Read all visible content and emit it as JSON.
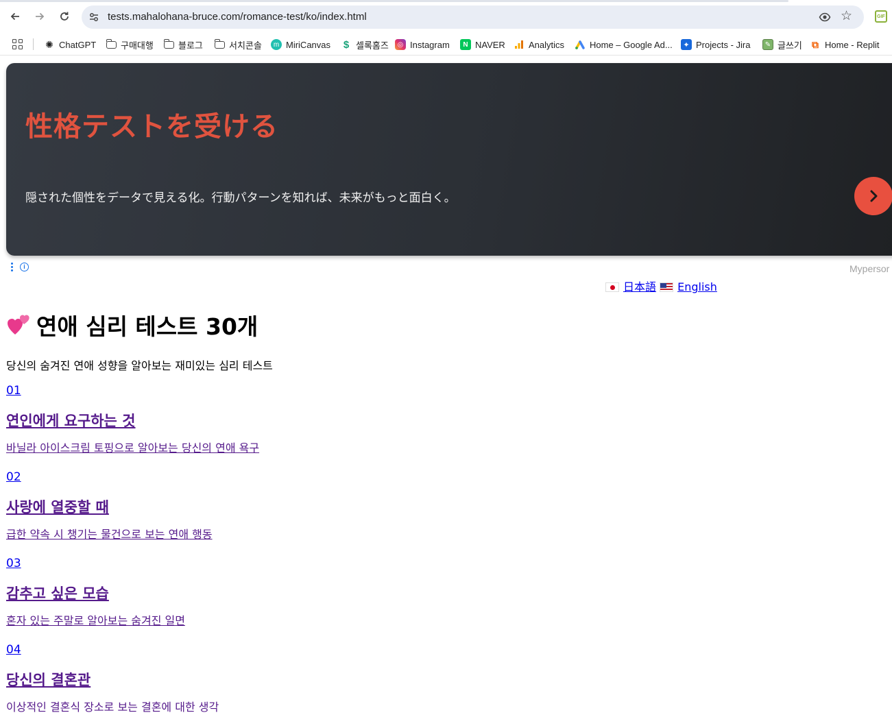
{
  "browser": {
    "url": "tests.mahalohana-bruce.com/romance-test/ko/index.html",
    "bookmarks": [
      {
        "label": "ChatGPT",
        "icon": "chatgpt-icon"
      },
      {
        "label": "구매대행",
        "icon": "folder-icon"
      },
      {
        "label": "블로그",
        "icon": "folder-icon"
      },
      {
        "label": "서치콘솔",
        "icon": "folder-icon"
      },
      {
        "label": "MiriCanvas",
        "icon": "miricanvas-icon"
      },
      {
        "label": "셀록홈즈",
        "icon": "sellhomes-icon"
      },
      {
        "label": "Instagram",
        "icon": "instagram-icon"
      },
      {
        "label": "NAVER",
        "icon": "naver-icon"
      },
      {
        "label": "Analytics",
        "icon": "analytics-icon"
      },
      {
        "label": "Home – Google Ad...",
        "icon": "google-ads-icon"
      },
      {
        "label": "Projects - Jira",
        "icon": "jira-icon"
      },
      {
        "label": "글쓰기",
        "icon": "writing-icon"
      },
      {
        "label": "Home - Replit",
        "icon": "replit-icon"
      }
    ]
  },
  "ad": {
    "title": "性格テストを受ける",
    "subtitle": "隠された個性をデータで見える化。行動パターンを知れば、未来がもっと面白く。",
    "brand": "Mypersor",
    "accent": "#e0533f"
  },
  "lang": {
    "japanese": "日本語",
    "english": "English"
  },
  "page": {
    "title": "연애 심리 테스트 30개",
    "description": "당신의 숨겨진 연애 성향을 알아보는 재미있는 심리 테스트"
  },
  "tests": [
    {
      "num": "01",
      "title": "연인에게 요구하는 것",
      "desc": "바닐라 아이스크림 토핑으로 알아보는 당신의 연애 욕구"
    },
    {
      "num": "02",
      "title": "사랑에 열중할 때",
      "desc": "급한 약속 시 챙기는 물건으로 보는 연애 행동"
    },
    {
      "num": "03",
      "title": "감추고 싶은 모습",
      "desc": "혼자 있는 주말로 알아보는 숨겨진 일면"
    },
    {
      "num": "04",
      "title": "당신의 결혼관",
      "desc": "이상적인 결혼식 장소로 보는 결혼에 대한 생각"
    }
  ]
}
